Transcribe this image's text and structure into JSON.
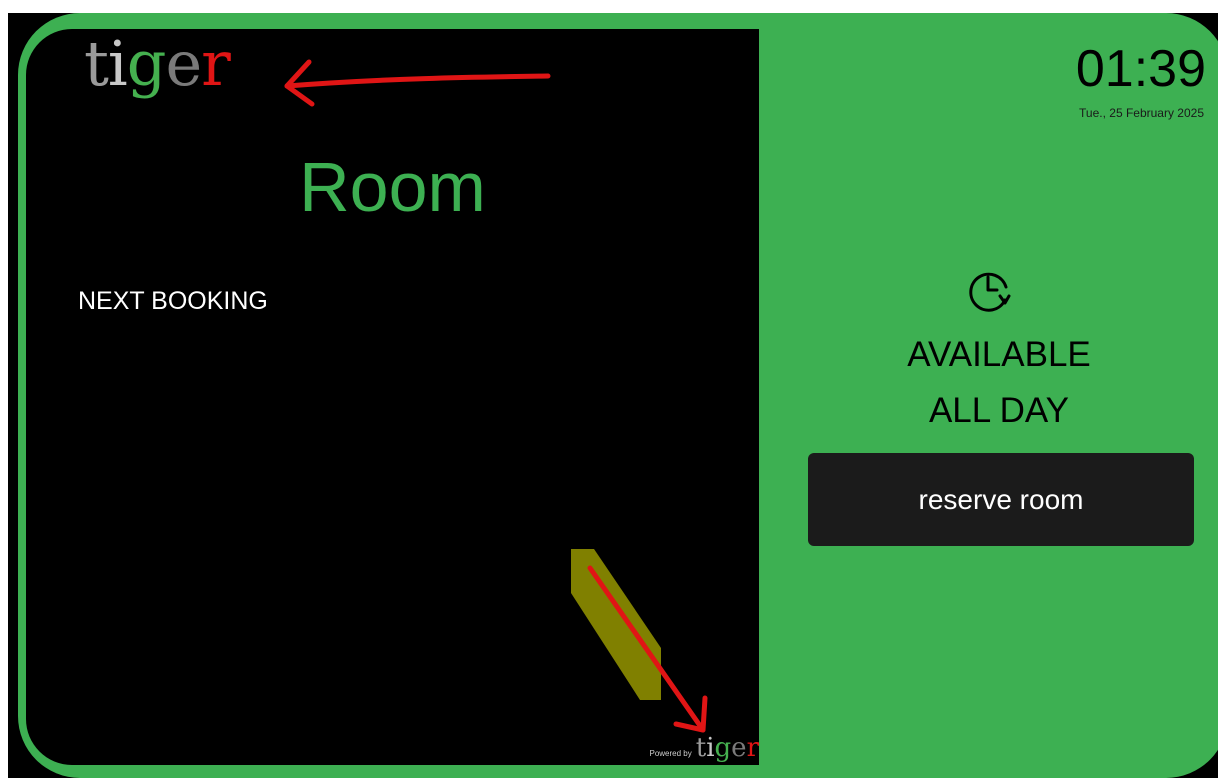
{
  "logo": {
    "letters": [
      "t",
      "i",
      "g",
      "e",
      "r"
    ]
  },
  "room": {
    "name": "Room"
  },
  "next_booking": {
    "label": "NEXT BOOKING"
  },
  "footer": {
    "powered_by": "Powered by"
  },
  "clock": {
    "time": "01:39",
    "date": "Tue., 25 February 2025"
  },
  "status": {
    "line1": "AVAILABLE",
    "line2": "ALL DAY",
    "icon": "clock-icon"
  },
  "actions": {
    "reserve_label": "reserve room"
  },
  "colors": {
    "accent": "#3db052",
    "panel": "#000000",
    "button": "#1b1b1b",
    "annotation_arrow": "#e01515",
    "annotation_highlight": "#808000"
  }
}
